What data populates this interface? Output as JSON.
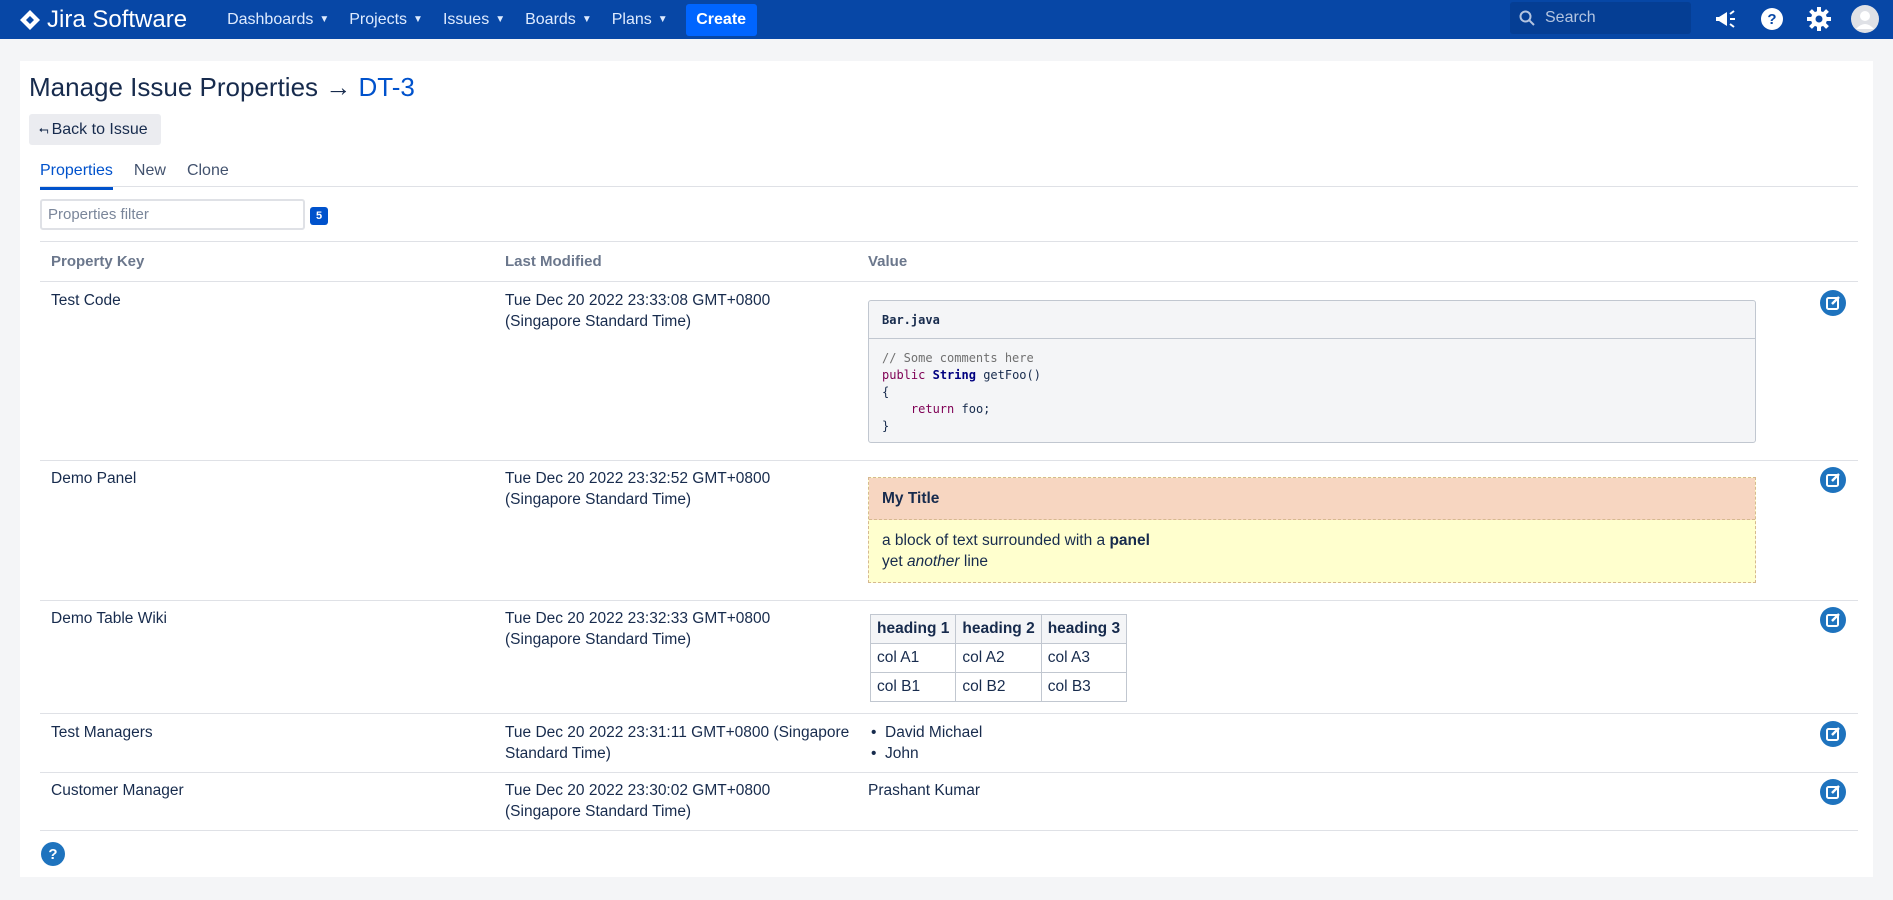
{
  "app": {
    "logo_text": "Jira Software",
    "nav": [
      {
        "label": "Dashboards"
      },
      {
        "label": "Projects"
      },
      {
        "label": "Issues"
      },
      {
        "label": "Boards"
      },
      {
        "label": "Plans"
      }
    ],
    "create_label": "Create",
    "search_placeholder": "Search",
    "icons": [
      "megaphone-icon",
      "help-icon",
      "gear-icon",
      "avatar-icon"
    ],
    "colors": {
      "nav_bg": "#0747a6",
      "create_bg": "#0065ff",
      "link": "#0052cc"
    }
  },
  "page": {
    "title_prefix": "Manage Issue Properties →",
    "issue_key": "DT-3",
    "back_label": "Back to Issue"
  },
  "tabs": [
    {
      "label": "Properties",
      "active": true
    },
    {
      "label": "New",
      "active": false
    },
    {
      "label": "Clone",
      "active": false
    }
  ],
  "filter": {
    "placeholder": "Properties filter",
    "count": "5"
  },
  "table": {
    "headers": [
      "Property Key",
      "Last Modified",
      "Value"
    ],
    "rows": [
      {
        "key": "Test Code",
        "modified_line1": "Tue Dec 20 2022 23:33:08 GMT+0800",
        "modified_line2": "(Singapore Standard Time)",
        "value": {
          "type": "code",
          "filename": "Bar.java",
          "lines": [
            "// Some comments here",
            "public String getFoo()",
            "{",
            "    return foo;",
            "}"
          ]
        }
      },
      {
        "key": "Demo Panel",
        "modified_line1": "Tue Dec 20 2022 23:32:52 GMT+0800",
        "modified_line2": "(Singapore Standard Time)",
        "value": {
          "type": "panel",
          "title": "My Title",
          "line1_text": "a block of text surrounded with a ",
          "line1_bold": "panel",
          "line2_text": "yet ",
          "line2_italic": "another",
          "line2_end": " line"
        }
      },
      {
        "key": "Demo Table Wiki",
        "modified_line1": "Tue Dec 20 2022 23:32:33 GMT+0800",
        "modified_line2": "(Singapore Standard Time)",
        "value": {
          "type": "table",
          "headers": [
            "heading 1",
            "heading 2",
            "heading 3"
          ],
          "rows": [
            [
              "col A1",
              "col A2",
              "col A3"
            ],
            [
              "col B1",
              "col B2",
              "col B3"
            ]
          ]
        }
      },
      {
        "key": "Test Managers",
        "modified_line1": "Tue Dec 20 2022 23:31:11 GMT+0800 (Singapore",
        "modified_line2": "Standard Time)",
        "value": {
          "type": "list",
          "items": [
            "David Michael",
            "John"
          ]
        }
      },
      {
        "key": "Customer Manager",
        "modified_line1": "Tue Dec 20 2022 23:30:02 GMT+0800",
        "modified_line2": "(Singapore Standard Time)",
        "value": {
          "type": "text",
          "text": "Prashant Kumar"
        }
      }
    ]
  }
}
